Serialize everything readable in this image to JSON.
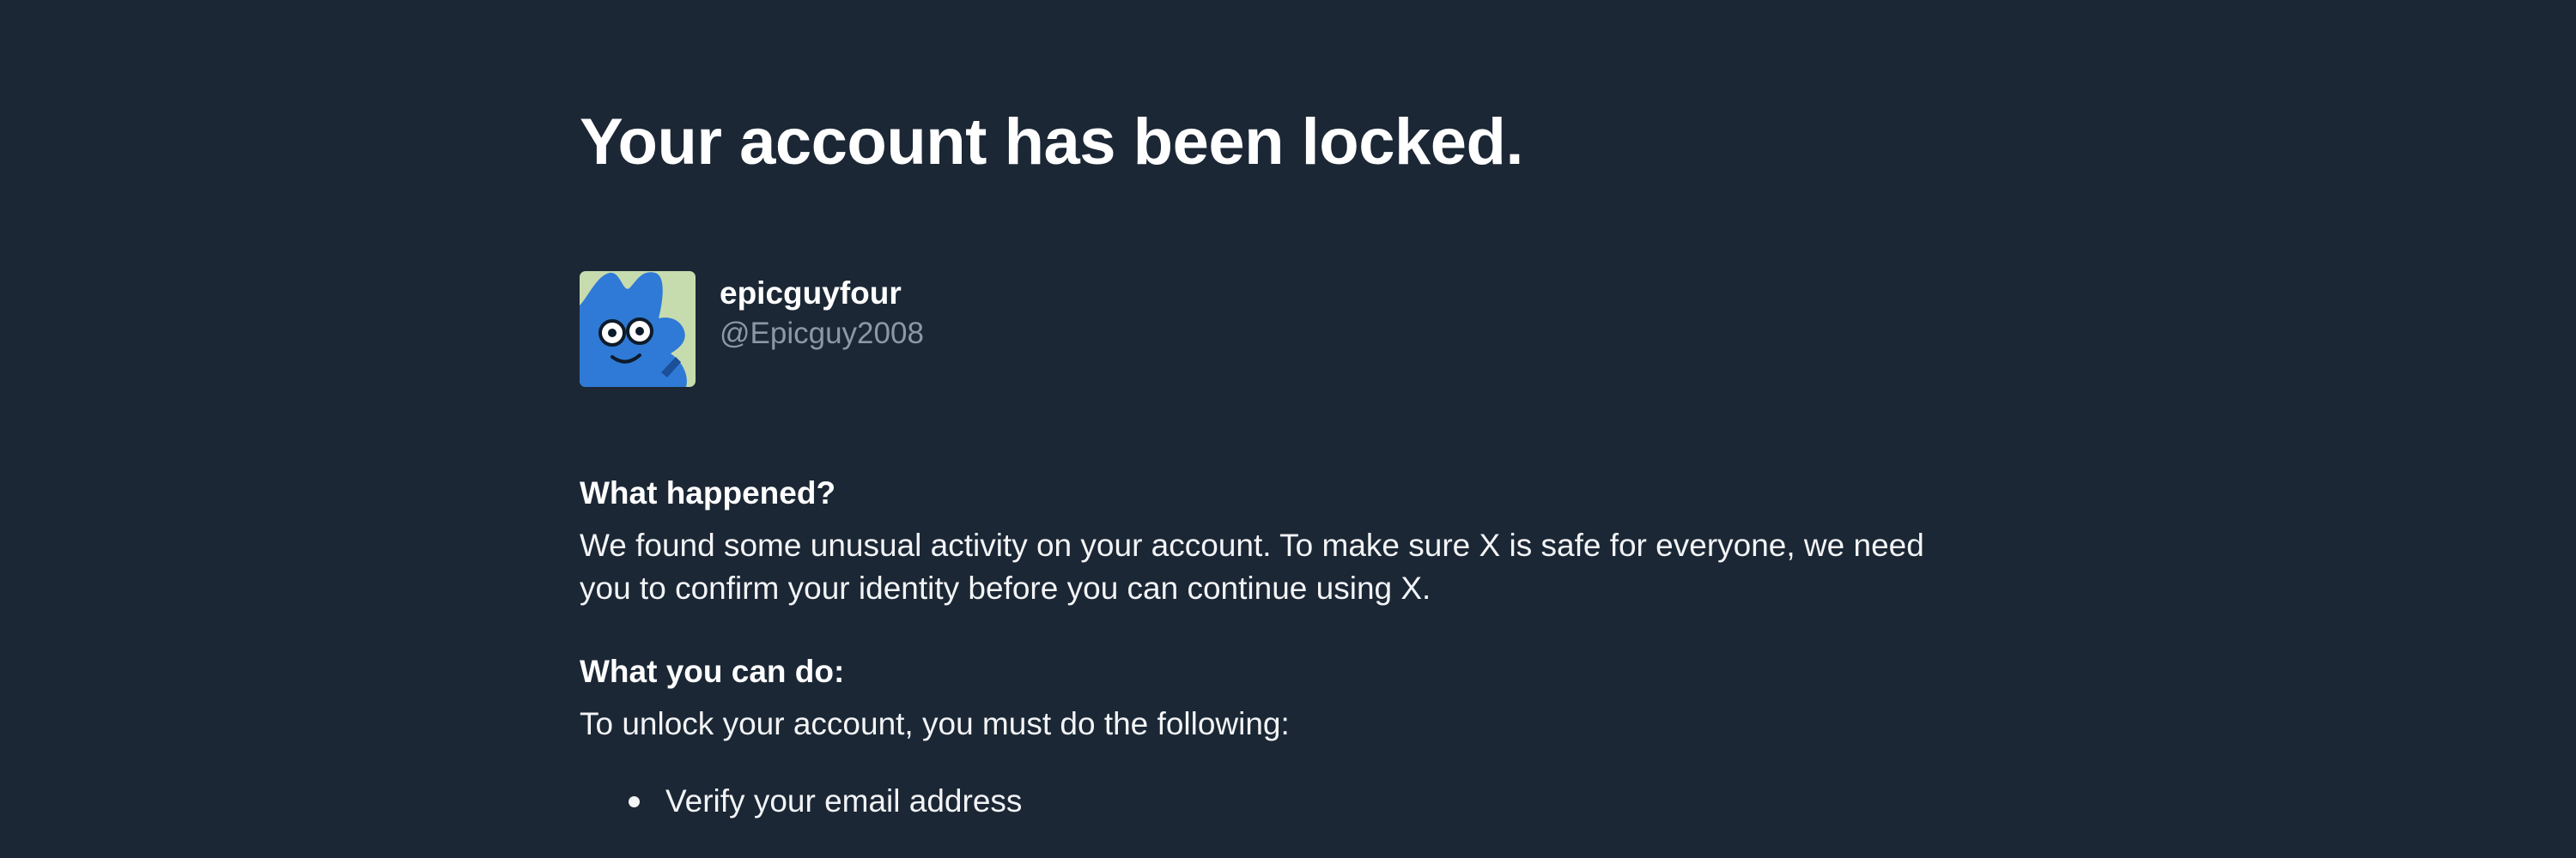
{
  "page": {
    "title": "Your account has been locked."
  },
  "user": {
    "display_name": "epicguyfour",
    "handle": "@Epicguy2008",
    "avatar": "cartoon-blue-character-avatar"
  },
  "sections": [
    {
      "heading": "What happened?",
      "text": "We found some unusual activity on your account. To make sure X is safe for everyone, we need you to confirm your identity before you can continue using X."
    },
    {
      "heading": "What you can do:",
      "text": "To unlock your account, you must do the following:"
    }
  ],
  "steps": [
    "Verify your email address"
  ],
  "colors": {
    "background": "#1b2735",
    "text": "#ffffff",
    "muted": "#8b98a5"
  }
}
